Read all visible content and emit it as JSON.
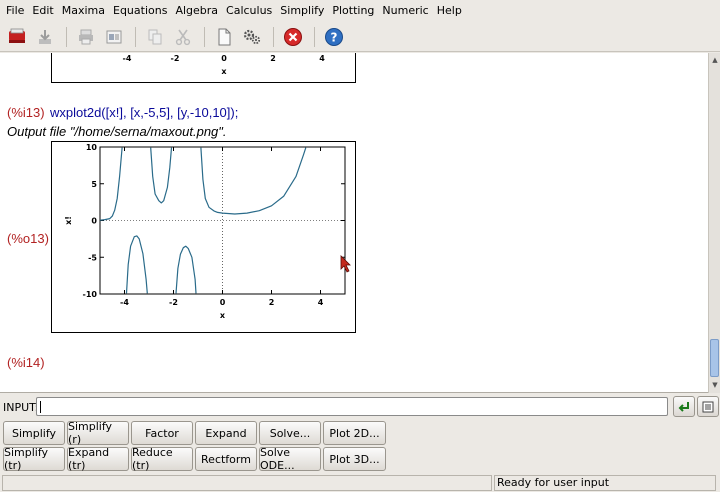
{
  "menu": [
    "File",
    "Edit",
    "Maxima",
    "Equations",
    "Algebra",
    "Calculus",
    "Simplify",
    "Plotting",
    "Numeric",
    "Help"
  ],
  "toolbar": {
    "icons": [
      "notebook-icon",
      "download-icon",
      "print-icon",
      "preview-icon",
      "copy-icon",
      "cut-icon",
      "new-page-icon",
      "settings-icon",
      "stop-icon",
      "help-icon"
    ]
  },
  "cells": {
    "prev_plot": {
      "x_ticks": [
        "-4",
        "-2",
        "0",
        "2",
        "4"
      ],
      "x_label": "x",
      "y_tick_partial": "-1"
    },
    "i13_label": "(%i13)",
    "i13_command": "wxplot2d([x!], [x,-5,5], [y,-10,10]);",
    "output_file": "Output file \"/home/serna/maxout.png\".",
    "o13_label": "(%o13)",
    "i14_label": "(%i14)"
  },
  "chart_data": {
    "type": "line",
    "title": "",
    "xlabel": "x",
    "ylabel": "x!",
    "xlim": [
      -5,
      5
    ],
    "ylim": [
      -10,
      10
    ],
    "x_ticks": [
      -4,
      -2,
      0,
      2,
      4
    ],
    "y_ticks": [
      10,
      5,
      0,
      -5,
      -10
    ],
    "color": "#2a6b8a",
    "grid": "dotted zero axes",
    "series": [
      {
        "segments": [
          [
            [
              -5.0,
              0.04
            ],
            [
              -4.8,
              0.12
            ],
            [
              -4.6,
              0.26
            ],
            [
              -4.5,
              0.6
            ],
            [
              -4.4,
              1.4
            ],
            [
              -4.3,
              3.0
            ],
            [
              -4.2,
              6.0
            ],
            [
              -4.1,
              9.9
            ]
          ],
          [
            [
              -3.92,
              -9.9
            ],
            [
              -3.85,
              -6.0
            ],
            [
              -3.75,
              -3.5
            ],
            [
              -3.6,
              -2.2
            ],
            [
              -3.5,
              -2.1
            ],
            [
              -3.4,
              -2.5
            ],
            [
              -3.25,
              -4.5
            ],
            [
              -3.12,
              -8.0
            ],
            [
              -3.07,
              -9.9
            ]
          ],
          [
            [
              -2.93,
              9.9
            ],
            [
              -2.85,
              6.0
            ],
            [
              -2.75,
              3.6
            ],
            [
              -2.6,
              2.7
            ],
            [
              -2.5,
              2.4
            ],
            [
              -2.4,
              2.7
            ],
            [
              -2.25,
              4.5
            ],
            [
              -2.15,
              7.2
            ],
            [
              -2.08,
              9.9
            ]
          ],
          [
            [
              -1.9,
              -9.9
            ],
            [
              -1.82,
              -6.5
            ],
            [
              -1.72,
              -4.6
            ],
            [
              -1.6,
              -3.7
            ],
            [
              -1.5,
              -3.5
            ],
            [
              -1.4,
              -3.8
            ],
            [
              -1.25,
              -5.0
            ],
            [
              -1.12,
              -8.0
            ],
            [
              -1.08,
              -9.9
            ]
          ],
          [
            [
              -0.88,
              9.9
            ],
            [
              -0.8,
              5.6
            ],
            [
              -0.7,
              3.0
            ],
            [
              -0.55,
              1.8
            ],
            [
              -0.35,
              1.3
            ],
            [
              -0.2,
              1.1
            ],
            [
              0.0,
              1.0
            ],
            [
              0.5,
              0.89
            ],
            [
              1.0,
              1.0
            ],
            [
              1.5,
              1.33
            ],
            [
              2.0,
              2.0
            ],
            [
              2.5,
              3.32
            ],
            [
              3.0,
              6.0
            ],
            [
              3.3,
              8.9
            ],
            [
              3.4,
              9.9
            ]
          ]
        ]
      }
    ]
  },
  "input_bar": {
    "label": "INPUT:",
    "value": ""
  },
  "buttons_row1": [
    "Simplify",
    "Simplify (r)",
    "Factor",
    "Expand",
    "Solve...",
    "Plot 2D..."
  ],
  "buttons_row2": [
    "Simplify (tr)",
    "Expand (tr)",
    "Reduce (tr)",
    "Rectform",
    "Solve ODE...",
    "Plot 3D..."
  ],
  "status": {
    "left": "",
    "right": "Ready for user input"
  },
  "colors": {
    "prompt": "#b22222",
    "command": "#0a0a9a",
    "curve": "#2a6b8a",
    "stop": "#d62a2a",
    "help": "#2f6fc2"
  }
}
